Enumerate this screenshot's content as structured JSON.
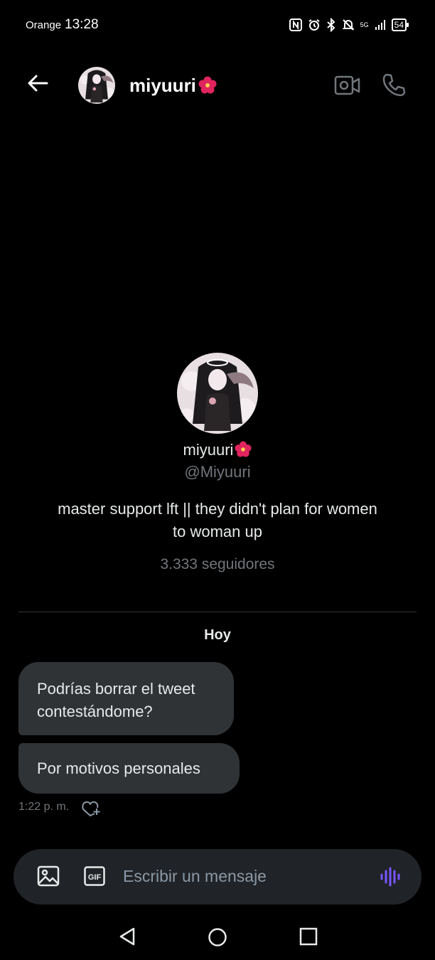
{
  "status_bar": {
    "carrier": "Orange",
    "time": "13:28",
    "network": "5G",
    "battery": "54",
    "icons": [
      "nfc-icon",
      "alarm-icon",
      "bluetooth-icon",
      "mute-bell-icon",
      "signal-icon",
      "battery-icon"
    ]
  },
  "header": {
    "name": "miyuuri",
    "emoji": "hibiscus",
    "icons": [
      "back-arrow-icon",
      "video-call-icon",
      "phone-call-icon"
    ]
  },
  "profile": {
    "name": "miyuuri",
    "handle": "@Miyuuri",
    "bio": "master support lft || they didn't plan for women to woman up",
    "followers": "3.333 seguidores"
  },
  "conversation": {
    "day_label": "Hoy",
    "messages": [
      {
        "text": "Podrías borrar el tweet contestándome?"
      },
      {
        "text": "Por motivos personales"
      }
    ],
    "time": "1:22 p. m."
  },
  "composer": {
    "placeholder": "Escribir un mensaje",
    "gif_label": "GIF",
    "accent_color": "#7856ff"
  },
  "colors": {
    "background": "#000000",
    "bubble": "#2f3336",
    "secondary_text": "#71767b",
    "composer_bg": "#202327",
    "flower": "#e0245e"
  }
}
